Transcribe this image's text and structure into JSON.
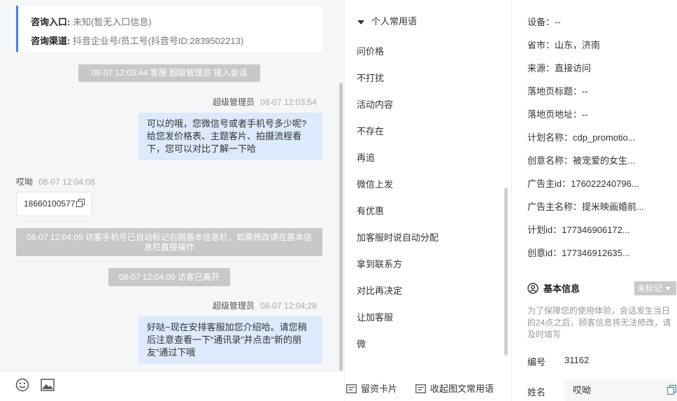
{
  "entry_card": {
    "entry_label": "咨询入口:",
    "entry_value": "未知(暂无入口信息)",
    "channel_label": "咨询渠道:",
    "channel_value": "抖音企业号/员工号(抖音号ID:2839502213)"
  },
  "messages": {
    "sys1": "08-07 12:03:44 客服 超级管理员 接入会话",
    "agent1_name": "超级管理员",
    "agent1_time": "08-07 12:03:54",
    "agent1_text": "可以的哦，您微信号或者手机号多少呢?给您发价格表、主题客片、拍摄流程看下，您可以对比了解一下哈",
    "visitor_name": "哎呦",
    "visitor_time": "08-07 12:04:08",
    "visitor_text": "18660100577",
    "sys2": "08-07 12:04:09 访客手机号已自动标记右侧基本信息栏，如需修改请在基本信息栏直接操作",
    "sys3": "08-07 12:04:09 访客已离开",
    "agent2_name": "超级管理员",
    "agent2_time": "08-07 12:04:28",
    "agent2_text": "好哒~现在安排客服加您介绍哈。请您稍后注意查看一下“通讯录”并点击“新的朋友”通过下哦"
  },
  "input_bar": {
    "emoji_icon": "smiley-icon",
    "image_icon": "image-icon",
    "card_icon": "card-icon",
    "card_label": "留资卡片",
    "collapse_label": "收起图文常用语"
  },
  "phrases": {
    "header": "个人常用语",
    "items": [
      "问价格",
      "不打扰",
      "活动内容",
      "不存在",
      "再追",
      "微信上发",
      "有优惠",
      "加客服时说自动分配",
      "拿到联系方",
      "对比再决定",
      "让加客服",
      "微"
    ]
  },
  "info": {
    "fields": [
      "设备：--",
      "省市：山东，济南",
      "来源：直接访问",
      "落地页标题：--",
      "落地页地址：--",
      "计划名称：cdp_promotio...",
      "创意名称：被宠爱的女生...",
      "广告主id：176022240796...",
      "广告主名称：提米映画婚前...",
      "计划id：177346906172...",
      "创意id：177346912635..."
    ],
    "section_title": "基本信息",
    "tag": "未标记",
    "notice": "为了保障您的使用体验，会话发生当日的24点之后，顾客信息将无法修改，请及时填写",
    "number_label": "编号",
    "number_value": "31162",
    "name_label": "姓名",
    "name_value": "哎呦"
  },
  "colors": {
    "accent": "#3b82f6",
    "agent_bubble": "#dde9fc",
    "system_bar": "#c8c8c8",
    "chat_bg": "#f5f6f8"
  }
}
